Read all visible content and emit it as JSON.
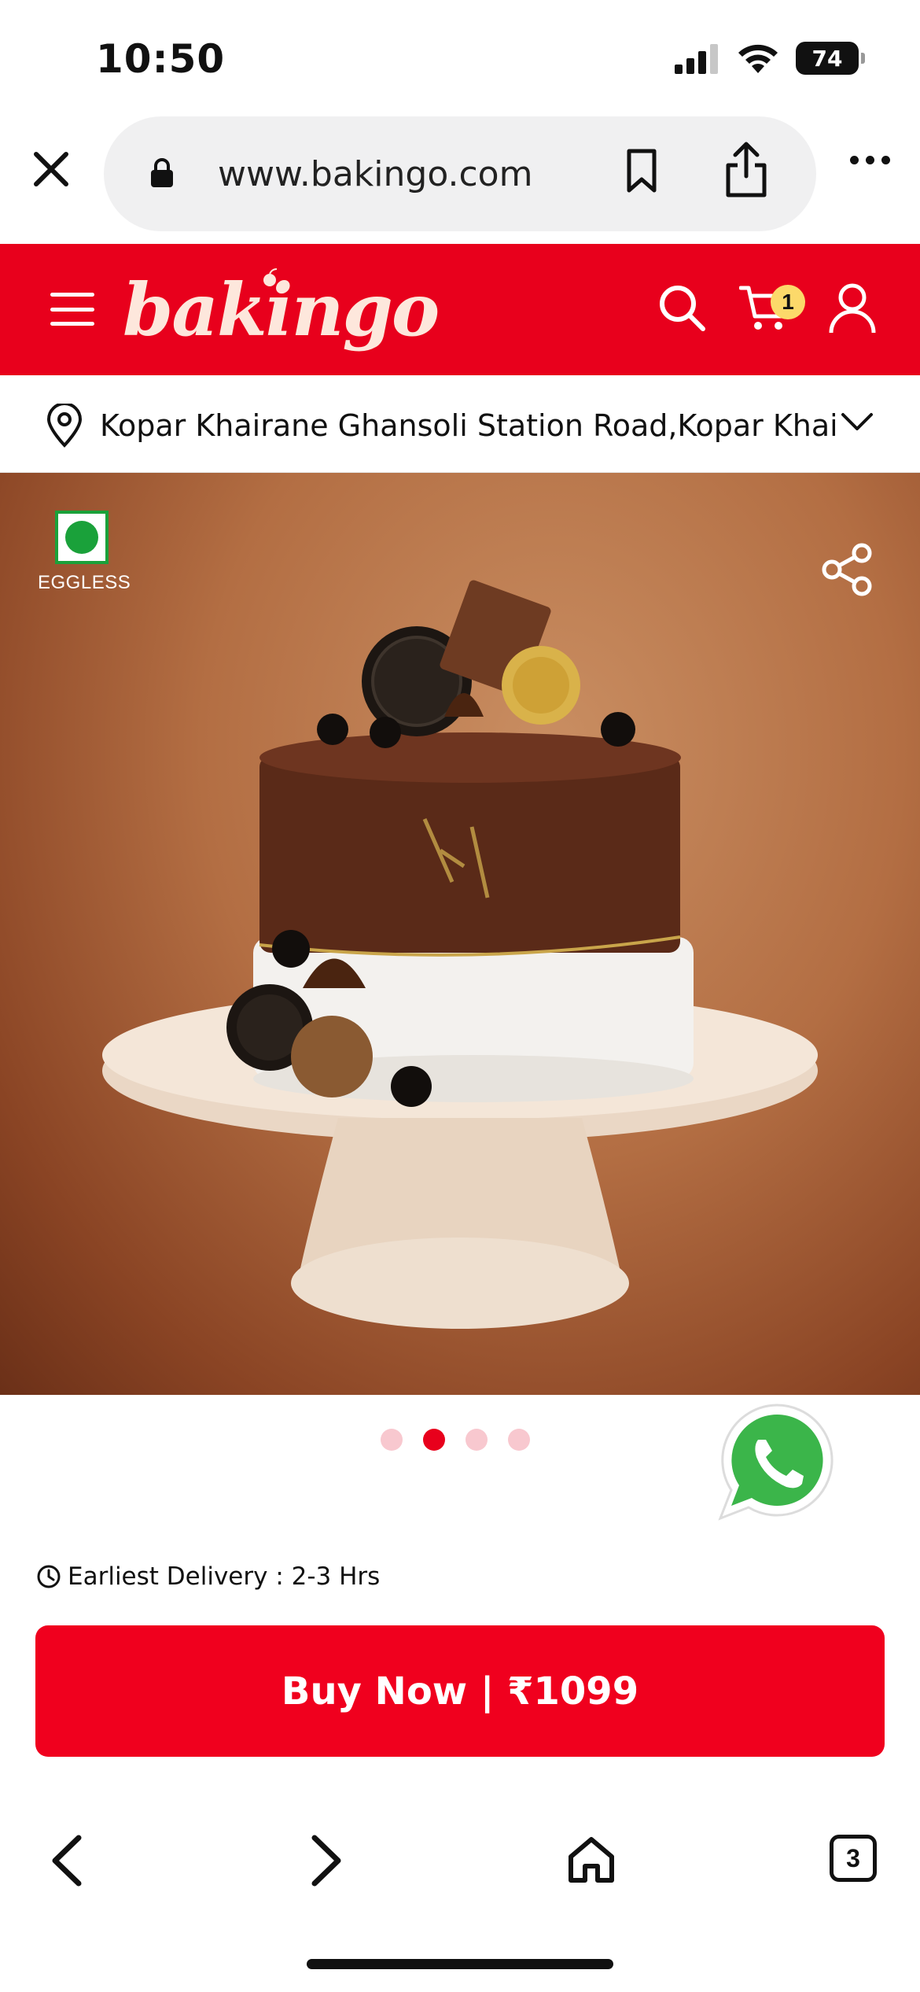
{
  "status_bar": {
    "time": "10:50",
    "battery": "74"
  },
  "browser": {
    "url": "www.bakingo.com",
    "icons": [
      "close-icon",
      "lock-icon",
      "bookmark-icon",
      "share-icon",
      "more-icon"
    ]
  },
  "header": {
    "logo": "bakingo",
    "cart_count": "1",
    "brand_color": "#e8001c",
    "icons": [
      "menu-icon",
      "search-icon",
      "cart-icon",
      "user-icon"
    ]
  },
  "location": {
    "address": "Kopar Khairane Ghansoli Station Road,Kopar Khairane"
  },
  "product": {
    "badge": "EGGLESS",
    "veg_color": "#1aa13a",
    "carousel": {
      "total": 4,
      "active_index": 1
    },
    "delivery_text": "Earliest Delivery : 2-3 Hrs",
    "buy_label": "Buy Now | ₹1099"
  },
  "bottom_toolbar": {
    "tabs_count": "3",
    "icons": [
      "back-icon",
      "forward-icon",
      "home-icon",
      "tabs-icon"
    ]
  }
}
